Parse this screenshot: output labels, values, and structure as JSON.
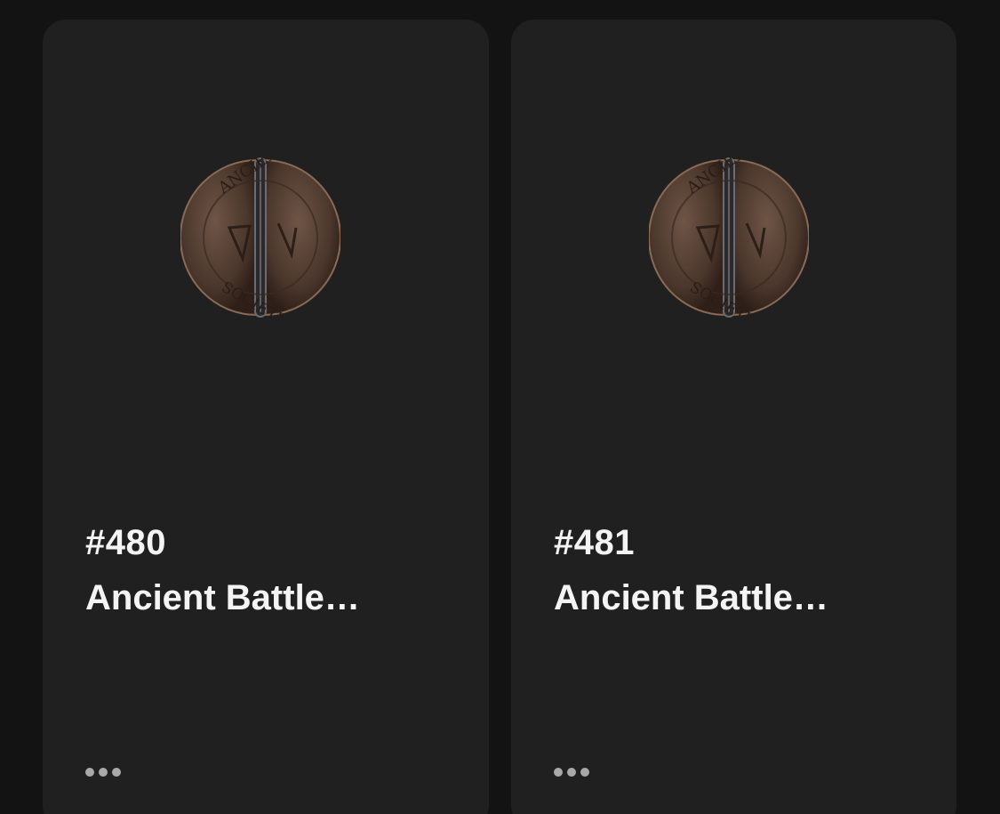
{
  "cards": [
    {
      "number": "#480",
      "name": "Ancient Battle…",
      "coin_text_top": "ANCIENT",
      "coin_text_bottom": "SOCIETY"
    },
    {
      "number": "#481",
      "name": "Ancient Battle…",
      "coin_text_top": "ANCIENT",
      "coin_text_bottom": "SOCIETY"
    }
  ],
  "colors": {
    "background": "#131313",
    "card": "#202020",
    "text": "#f4f4f4",
    "dots": "#a9a9a9",
    "coin": "#5a4335"
  },
  "icons": {
    "coin": "coin-image",
    "more": "more-horizontal-icon"
  }
}
